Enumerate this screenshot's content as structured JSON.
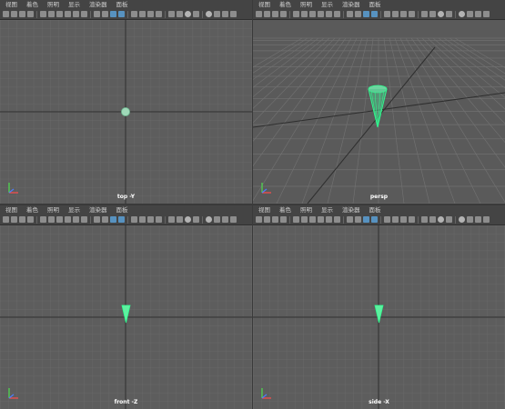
{
  "menu": [
    "视图",
    "着色",
    "照明",
    "显示",
    "渲染器",
    "面板"
  ],
  "viewports": {
    "top": {
      "label": "top -Y"
    },
    "persp": {
      "label": "persp"
    },
    "front": {
      "label": "front -Z"
    },
    "side": {
      "label": "side -X"
    }
  },
  "active_viewport": "front",
  "colors": {
    "viewport_bg": "#5d5d5d",
    "grid": "#6a6a6a",
    "axis_line": "#2e2e2e",
    "object_green": "#5ef0a0",
    "highlight": "#e03a3a",
    "toolbar_icon_active": "#5aa0d6"
  },
  "icons": [
    "camera-icon",
    "film-icon",
    "film-gate-icon",
    "grid-icon",
    "wireframe-icon",
    "smooth-shade-icon",
    "texture-icon",
    "light-icon",
    "shadow-icon",
    "isolate-icon",
    "xray-icon",
    "sphere-icon",
    "ao-icon",
    "aa-icon"
  ]
}
